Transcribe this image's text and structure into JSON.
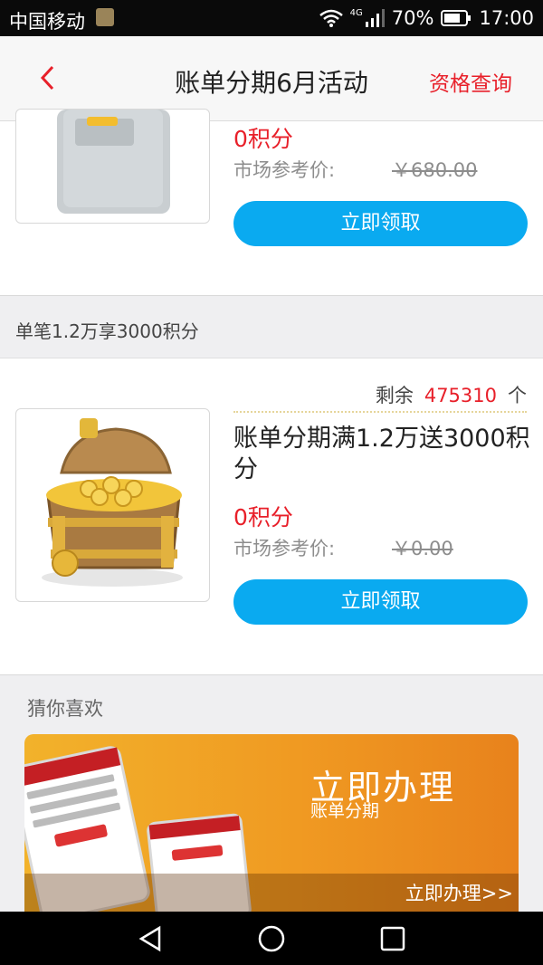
{
  "status_bar": {
    "carrier": "中国移动",
    "network": "4G",
    "battery": "70%",
    "time": "17:00"
  },
  "header": {
    "title": "账单分期6月活动",
    "action": "资格查询"
  },
  "product_1": {
    "points": "0积分",
    "market_label": "市场参考价:",
    "market_price": "￥680.00",
    "button": "立即领取"
  },
  "section_label": "单笔1.2万享3000积分",
  "product_2": {
    "remain_label": "剩余",
    "remain_count": "475310",
    "remain_unit": "个",
    "title": "账单分期满1.2万送3000积分",
    "points": "0积分",
    "market_label": "市场参考价:",
    "market_price": "￥0.00",
    "button": "立即领取"
  },
  "guess_label": "猜你喜欢",
  "banner": {
    "headline": "立即办理",
    "subtitle": "账单分期",
    "cta": "立即办理>>"
  },
  "colors": {
    "accent_red": "#e8202a",
    "button_blue": "#0aaaf0",
    "banner_orange": "#f09a22"
  }
}
